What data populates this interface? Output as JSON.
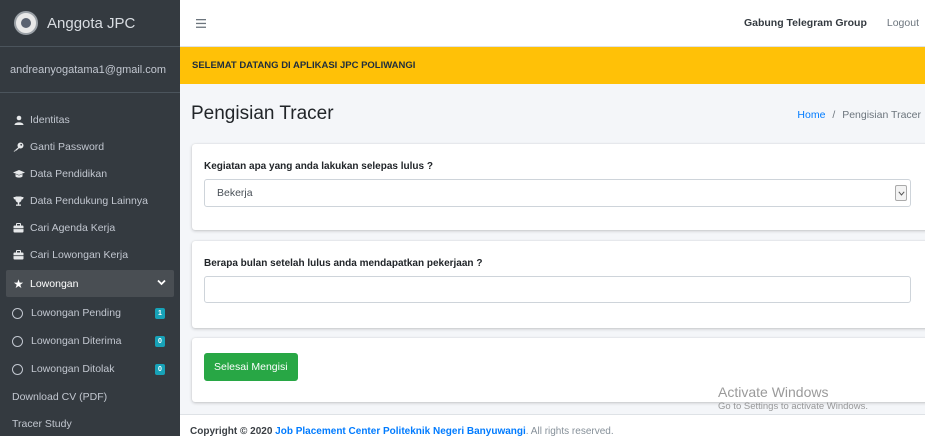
{
  "sidebar": {
    "brand": "Anggota JPC",
    "user_email": "andreanyogatama1@gmail.com",
    "items": [
      {
        "label": "Identitas",
        "icon": "user-icon"
      },
      {
        "label": "Ganti Password",
        "icon": "key-icon"
      },
      {
        "label": "Data Pendidikan",
        "icon": "graduation-cap-icon"
      },
      {
        "label": "Data Pendukung Lainnya",
        "icon": "trophy-icon"
      },
      {
        "label": "Cari Agenda Kerja",
        "icon": "briefcase-icon"
      },
      {
        "label": "Cari Lowongan Kerja",
        "icon": "briefcase-icon"
      },
      {
        "label": "Lowongan",
        "icon": "star-icon",
        "expanded": true
      },
      {
        "label": "Lowongan Pending",
        "icon": "circle-icon",
        "badge": "1"
      },
      {
        "label": "Lowongan Diterima",
        "icon": "circle-icon",
        "badge": "0"
      },
      {
        "label": "Lowongan Ditolak",
        "icon": "circle-icon",
        "badge": "0"
      },
      {
        "label": "Download CV (PDF)"
      },
      {
        "label": "Tracer Study"
      }
    ]
  },
  "navbar": {
    "telegram": "Gabung Telegram Group",
    "logout": "Logout"
  },
  "banner": "SELEMAT DATANG DI APLIKASI JPC POLIWANGI",
  "content": {
    "title": "Pengisian Tracer",
    "breadcrumb_home": "Home",
    "breadcrumb_sep": "/",
    "breadcrumb_current": "Pengisian Tracer"
  },
  "form": {
    "q1_label": "Kegiatan apa yang anda lakukan selepas lulus ?",
    "q1_value": "Bekerja",
    "q2_label": "Berapa bulan setelah lulus anda mendapatkan pekerjaan ?",
    "q2_value": "",
    "submit": "Selesai Mengisi"
  },
  "footer": {
    "prefix": "Copyright © 2020",
    "org": "Job Placement Center Politeknik Negeri Banyuwangi",
    "suffix": ". All rights reserved."
  },
  "watermark": {
    "line1": "Activate Windows",
    "line2": "Go to Settings to activate Windows."
  },
  "colors": {
    "sidebar_bg": "#343a40",
    "banner_bg": "#ffc107",
    "primary": "#007bff",
    "success": "#28a745",
    "badge": "#17a2b8"
  }
}
